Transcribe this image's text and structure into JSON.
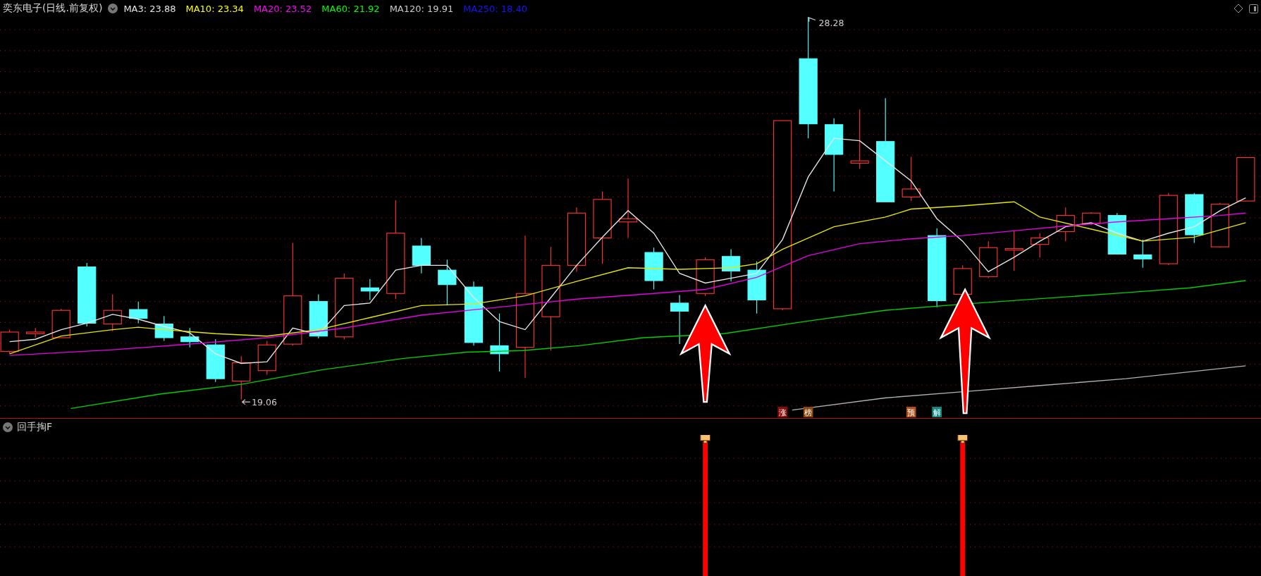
{
  "chart": {
    "title": "奕东电子(日线.前复权)",
    "legend": [
      {
        "label": "MA3: 23.88",
        "color": "#e6e6e6"
      },
      {
        "label": "MA10: 23.34",
        "color": "#ffff00"
      },
      {
        "label": "MA20: 23.52",
        "color": "#ff00ff"
      },
      {
        "label": "MA60: 21.92",
        "color": "#00ff00"
      },
      {
        "label": "MA120: 19.91",
        "color": "#c8c8c8"
      },
      {
        "label": "MA250: 18.40",
        "color": "#1414ff"
      }
    ],
    "high_label": "28.28",
    "low_label": "19.06",
    "event_tags": [
      {
        "label": "涨",
        "color": "#8b0a0a"
      },
      {
        "label": "榜",
        "color": "#8a4a10"
      },
      {
        "label": "预",
        "color": "#b0501a"
      },
      {
        "label": "解",
        "color": "#128a84"
      }
    ]
  },
  "indicator": {
    "title": "回手掏F"
  }
}
